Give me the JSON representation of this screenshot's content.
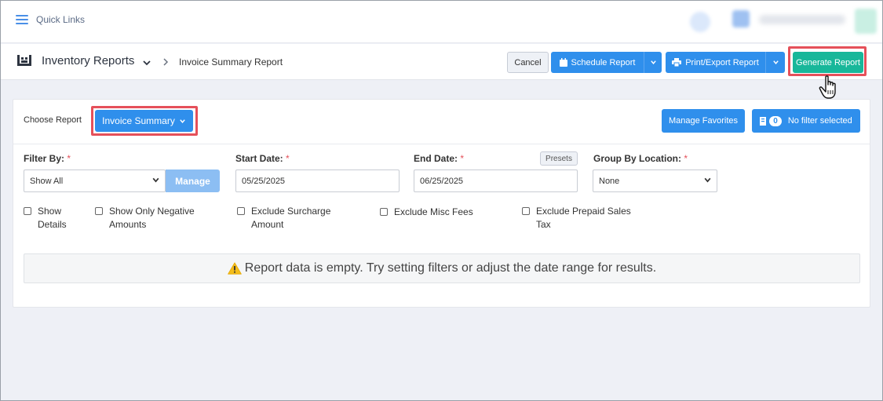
{
  "topbar": {
    "quick_links_label": "Quick Links"
  },
  "header": {
    "title": "Inventory Reports",
    "breadcrumb_separator": ">",
    "breadcrumb_current": "Invoice Summary Report",
    "cancel_label": "Cancel",
    "schedule_label": "Schedule Report",
    "print_label": "Print/Export Report",
    "generate_label": "Generate Report",
    "generate_color": "#18b79a",
    "primary_color": "#2f8fec",
    "highlight_color": "#e5505a"
  },
  "report": {
    "choose_label": "Choose Report",
    "selected_report": "Invoice Summary",
    "manage_favorites_label": "Manage Favorites",
    "filter_count": "0",
    "filter_status": "No filter selected"
  },
  "filters": {
    "filter_by_label": "Filter By:",
    "filter_by_value": "Show All",
    "manage_label": "Manage",
    "start_date_label": "Start Date:",
    "start_date_value": "05/25/2025",
    "end_date_label": "End Date:",
    "end_date_value": "06/25/2025",
    "presets_label": "Presets",
    "group_by_label": "Group By Location:",
    "group_by_value": "None",
    "required_mark": "*"
  },
  "options": [
    {
      "line1": "Show",
      "line2": "Details"
    },
    {
      "line1": "Show Only Negative",
      "line2": "Amounts"
    },
    {
      "line1": "Exclude Surcharge",
      "line2": "Amount"
    },
    {
      "line1": "Exclude Misc Fees",
      "line2": ""
    },
    {
      "line1": "Exclude Prepaid Sales",
      "line2": "Tax"
    }
  ],
  "message": {
    "empty_text": "Report data is empty. Try setting filters or adjust the date range for results."
  }
}
